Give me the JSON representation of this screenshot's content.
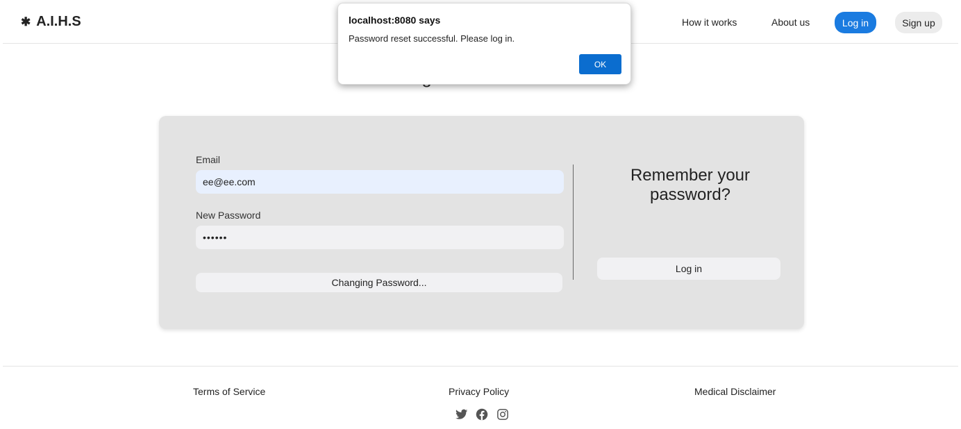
{
  "header": {
    "brand": "A.I.H.S",
    "brand_icon": "asterisk-icon",
    "nav": {
      "how_it_works": "How it works",
      "about_us": "About us",
      "login": "Log in",
      "signup": "Sign up"
    },
    "login_color": "#1a7be0"
  },
  "main": {
    "title": "Forgotten Password?",
    "form": {
      "email_label": "Email",
      "email_value": "ee@ee.com",
      "password_label": "New Password",
      "password_value": "••••••",
      "submit_label": "Changing Password..."
    },
    "aside": {
      "title": "Remember your password?",
      "login_label": "Log in"
    }
  },
  "footer": {
    "terms": "Terms of Service",
    "privacy": "Privacy Policy",
    "medical": "Medical Disclaimer",
    "social_icons": [
      "twitter-icon",
      "facebook-icon",
      "instagram-icon"
    ]
  },
  "dialog": {
    "title": "localhost:8080 says",
    "message": "Password reset successful. Please log in.",
    "ok": "OK",
    "ok_color": "#0b6dcf"
  }
}
